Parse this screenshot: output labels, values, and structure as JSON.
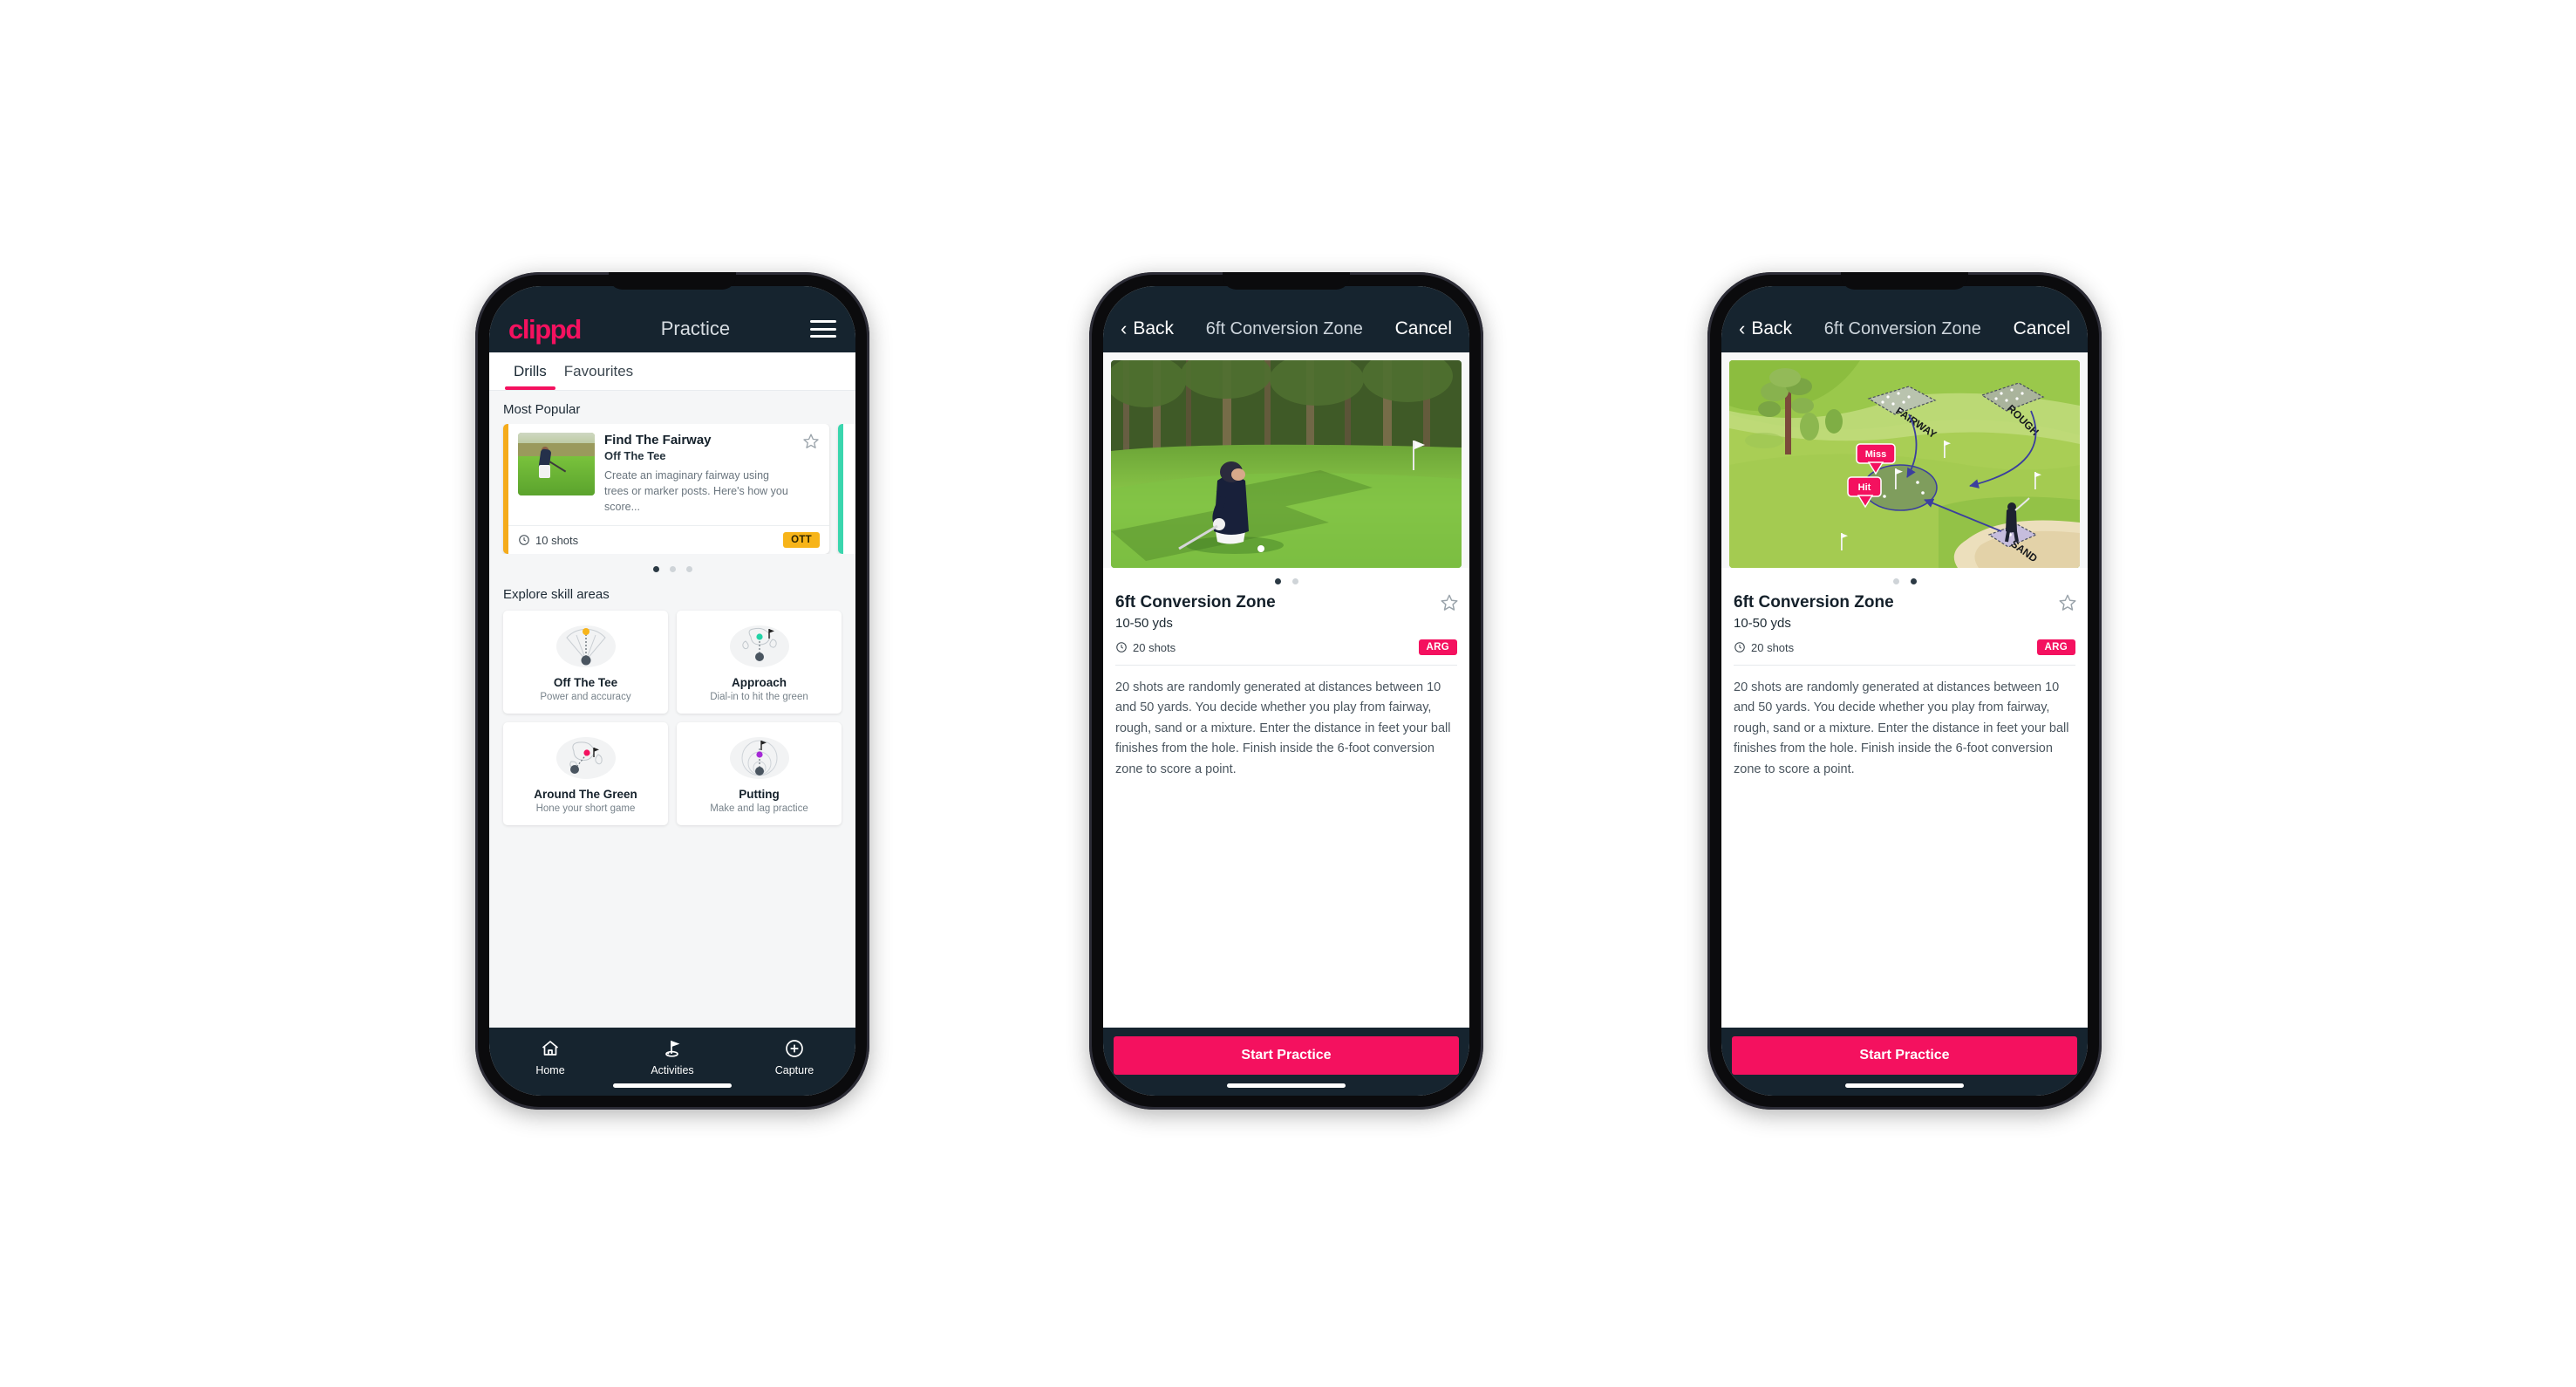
{
  "phones": [
    {
      "id": "practice-list",
      "header": {
        "brand": "clippd",
        "title": "Practice",
        "menu_icon": "hamburger-icon"
      },
      "tabs": [
        {
          "label": "Drills",
          "active": true
        },
        {
          "label": "Favourites",
          "active": false
        }
      ],
      "sections": {
        "most_popular_label": "Most Popular",
        "explore_label": "Explore skill areas"
      },
      "drill_card": {
        "title": "Find The Fairway",
        "subtitle": "Off The Tee",
        "description": "Create an imaginary fairway using trees or marker posts. Here's how you score...",
        "shots": "10 shots",
        "badge": "OTT",
        "badge_color": "#f7b419",
        "accent_color": "#f5ab1b",
        "next_card_accent": "#3ad6ae",
        "favourite_icon": "star-outline-icon",
        "shots_icon": "clock-icon"
      },
      "carousel_dots": {
        "count": 3,
        "active_index": 0
      },
      "skill_areas": [
        {
          "name": "Off The Tee",
          "desc": "Power and accuracy",
          "icon": "tee-fan-icon",
          "dot_color": "#f7b419"
        },
        {
          "name": "Approach",
          "desc": "Dial-in to hit the green",
          "icon": "green-approach-icon",
          "dot_color": "#22d3a6"
        },
        {
          "name": "Around The Green",
          "desc": "Hone your short game",
          "icon": "chip-green-icon",
          "dot_color": "#f4115f"
        },
        {
          "name": "Putting",
          "desc": "Make and lag practice",
          "icon": "putting-rings-icon",
          "dot_color": "#a529d6"
        }
      ],
      "tabbar": [
        {
          "label": "Home",
          "icon": "home-icon",
          "active": false
        },
        {
          "label": "Activities",
          "icon": "golf-flag-icon",
          "active": true
        },
        {
          "label": "Capture",
          "icon": "plus-circle-icon",
          "active": false
        }
      ]
    },
    {
      "id": "drill-detail-video",
      "header": {
        "back_label": "Back",
        "title": "6ft Conversion Zone",
        "cancel_label": "Cancel",
        "back_icon": "chevron-left-icon"
      },
      "hero_type": "photo",
      "hero_alt": "golfer-chipping-photo",
      "dots": {
        "count": 2,
        "active_index": 0
      },
      "detail": {
        "title": "6ft Conversion Zone",
        "subtitle": "10-50 yds",
        "shots": "20 shots",
        "badge": "ARG",
        "badge_color": "#f4115f",
        "favourite_icon": "star-outline-icon",
        "shots_icon": "clock-icon",
        "description": "20 shots are randomly generated at distances between 10 and 50 yards. You decide whether you play from fairway, rough, sand or a mixture. Enter the distance in feet your ball finishes from the hole. Finish inside the 6-foot conversion zone to score a point."
      },
      "cta": "Start Practice"
    },
    {
      "id": "drill-detail-diagram",
      "header": {
        "back_label": "Back",
        "title": "6ft Conversion Zone",
        "cancel_label": "Cancel",
        "back_icon": "chevron-left-icon"
      },
      "hero_type": "diagram",
      "hero_alt": "golf-course-diagram",
      "diagram": {
        "zone_labels": [
          "FAIRWAY",
          "ROUGH",
          "SAND"
        ],
        "markers": [
          {
            "label": "Miss",
            "color": "#f4115f"
          },
          {
            "label": "Hit",
            "color": "#f4115f"
          }
        ],
        "arrow_color": "#3b3f9e",
        "green_color": "#7c9e5b",
        "fairway_color": "#a7cc52",
        "rough_color": "#8cb43f",
        "sand_color": "#e9dcb6"
      },
      "dots": {
        "count": 2,
        "active_index": 1
      },
      "detail": {
        "title": "6ft Conversion Zone",
        "subtitle": "10-50 yds",
        "shots": "20 shots",
        "badge": "ARG",
        "badge_color": "#f4115f",
        "favourite_icon": "star-outline-icon",
        "shots_icon": "clock-icon",
        "description": "20 shots are randomly generated at distances between 10 and 50 yards. You decide whether you play from fairway, rough, sand or a mixture. Enter the distance in feet your ball finishes from the hole. Finish inside the 6-foot conversion zone to score a point."
      },
      "cta": "Start Practice"
    }
  ],
  "theme": {
    "navy": "#16242f",
    "pink": "#f4115f",
    "amber": "#f7b419",
    "teal": "#3ad6ae",
    "page_bg": "#ffffff"
  }
}
